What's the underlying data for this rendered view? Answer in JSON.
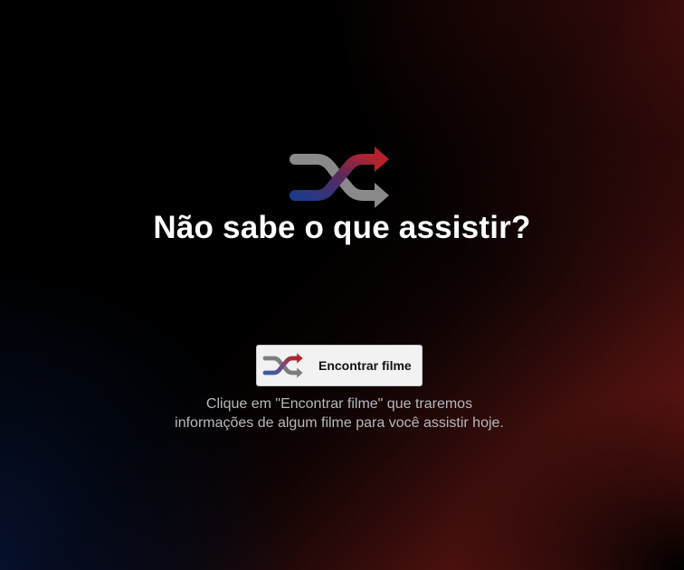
{
  "hero": {
    "icon": "shuffle-icon",
    "title": "Não sabe o que assistir?"
  },
  "action": {
    "icon": "shuffle-icon",
    "label": "Encontrar filme"
  },
  "description": {
    "line1": "Clique em \"Encontrar filme\" que traremos",
    "line2": "informações de algum filme para você assistir hoje."
  },
  "colors": {
    "background_red": "#7a1a16",
    "background_blue": "#0e225c",
    "background_base": "#000000",
    "icon_red": "#b4232c",
    "icon_blue": "#1f3a8c",
    "icon_gray": "#8a8a8a",
    "button_bg": "#f2f2f2",
    "title_text": "#ffffff",
    "description_text": "#b8b8bc"
  }
}
